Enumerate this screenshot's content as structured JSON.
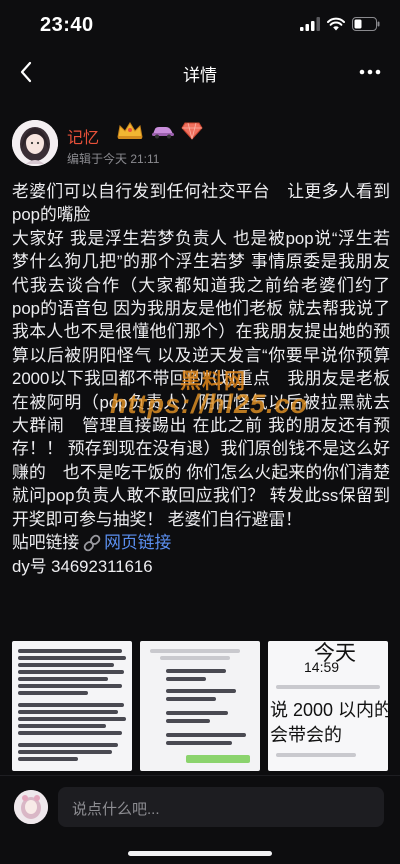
{
  "status": {
    "time": "23:40"
  },
  "nav": {
    "title": "详情"
  },
  "post": {
    "author": "记忆",
    "edit_time": "编辑于今天 21:11",
    "paragraphs": [
      "老婆们可以自行发到任何社交平台　让更多人看到pop的嘴脸",
      "大家好 我是浮生若梦负责人 也是被pop说“浮生若梦什么狗几把”的那个浮生若梦 事情原委是我朋友代我去谈合作（大家都知道我之前给老婆们约了pop的语音包 因为我朋友是他们老板 就去帮我说了　我本人也不是很懂他们那个）在我朋友提出她的预算以后被阴阳怪气 以及逆天发言“你要早说你预算2000以下我回都不带回的”（划重点　我朋友是老板　在被阿明（pop负责人）阴阳怪气以后被拉黑就去大群闹　管理直接踢出 在此之前 我的朋友还有预存！！ 预存到现在没有退）我们原创钱不是这么好赚的　也不是吃干饭的 你们怎么火起来的你们清楚 就问pop负责人敢不敢回应我们？ 转发此ss保留到开奖即可参与抽奖！ 老婆们自行避雷！"
    ],
    "tieba_label": "贴吧链接",
    "link_text": "网页链接",
    "dy_line": "dy号 34692311616"
  },
  "watermark": {
    "top": "黑料网",
    "url": "https://hl25.co"
  },
  "images": {
    "thumb3_line1": "今天",
    "thumb3_line2": "14:59",
    "thumb3_line3": "说 2000 以内的",
    "thumb3_line4": "会带会的"
  },
  "comment": {
    "placeholder": "说点什么吧..."
  },
  "colors": {
    "accent": "#e8513a",
    "link": "#5b8ff0",
    "background": "#0d0d0f"
  }
}
